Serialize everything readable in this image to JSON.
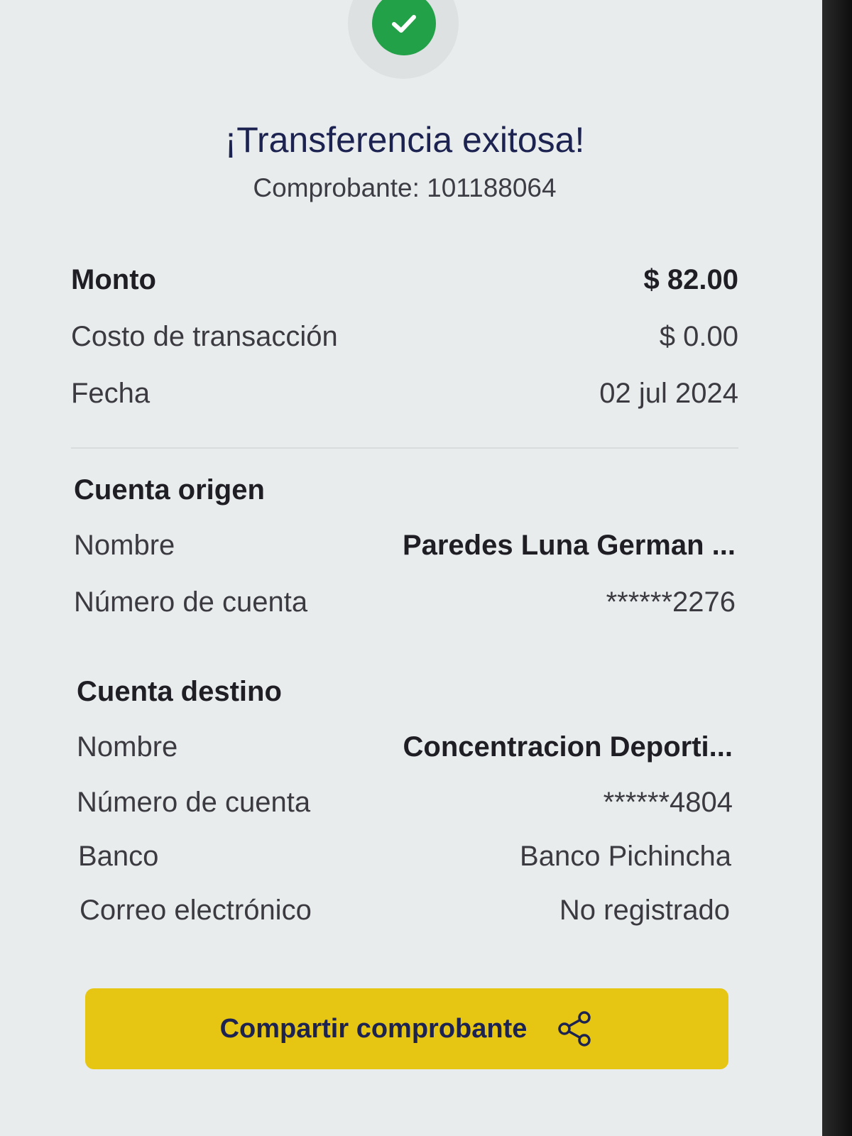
{
  "header": {
    "title": "¡Transferencia exitosa!",
    "receipt": "Comprobante: 101188064"
  },
  "summary": {
    "amount": {
      "label": "Monto",
      "value": "$ 82.00"
    },
    "fee": {
      "label": "Costo de transacción",
      "value": "$ 0.00"
    },
    "date": {
      "label": "Fecha",
      "value": "02 jul 2024"
    }
  },
  "origin": {
    "title": "Cuenta origen",
    "name": {
      "label": "Nombre",
      "value": "Paredes  Luna German ..."
    },
    "account": {
      "label": "Número de cuenta",
      "value": "******2276"
    }
  },
  "destination": {
    "title": "Cuenta destino",
    "name": {
      "label": "Nombre",
      "value": "Concentracion Deporti..."
    },
    "account": {
      "label": "Número de cuenta",
      "value": "******4804"
    },
    "bank": {
      "label": "Banco",
      "value": "Banco Pichincha"
    },
    "email": {
      "label": "Correo electrónico",
      "value": "No registrado"
    }
  },
  "actions": {
    "share_label": "Compartir comprobante"
  },
  "icons": {
    "success": "check-icon",
    "share": "share-icon"
  },
  "colors": {
    "success_green": "#23a149",
    "button_yellow": "#e6c613",
    "title_navy": "#1d2350"
  }
}
